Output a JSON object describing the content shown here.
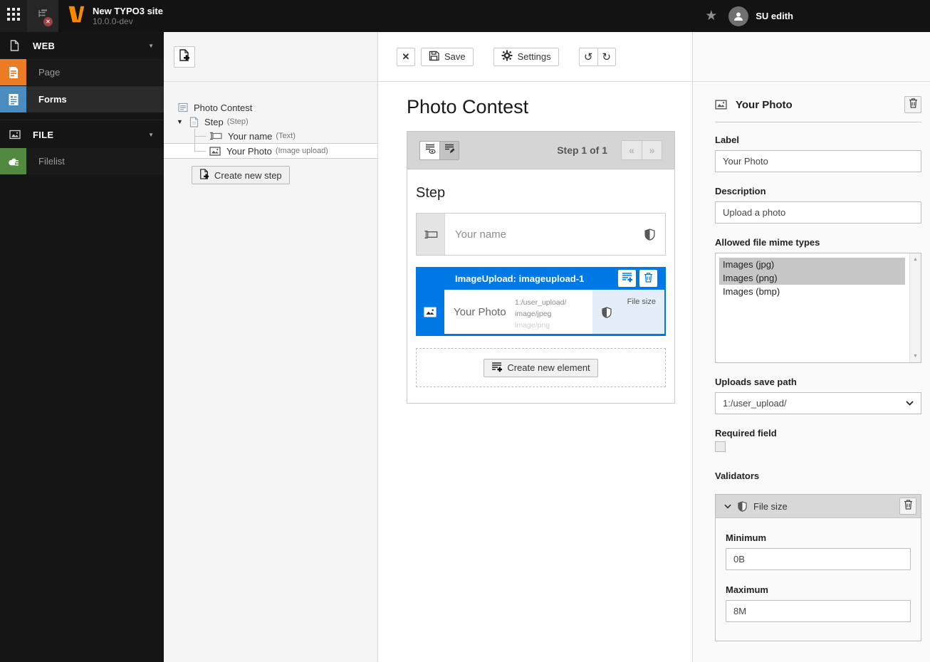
{
  "topbar": {
    "site_title": "New TYPO3 site",
    "site_version": "10.0.0-dev",
    "username": "SU edith"
  },
  "icons": {
    "close": "✕",
    "undo": "↺",
    "redo": "↻",
    "star": "★",
    "caret_down": "▼",
    "error_x": "✕",
    "scroll_up": "▲",
    "scroll_down": "▼"
  },
  "modulemenu": {
    "web_section": "WEB",
    "page": "Page",
    "forms": "Forms",
    "file_section": "FILE",
    "filelist": "Filelist"
  },
  "tree": {
    "root": "Photo Contest",
    "step_label": "Step",
    "step_type": "(Step)",
    "name_label": "Your name",
    "name_type": "(Text)",
    "photo_label": "Your Photo",
    "photo_type": "(Image upload)",
    "create_step": "Create new step"
  },
  "toolbar": {
    "save": "Save",
    "settings": "Settings"
  },
  "stage": {
    "title": "Photo Contest",
    "paginator": "Step 1 of 1",
    "prev": "«",
    "next": "»",
    "step_heading": "Step",
    "name_placeholder": "Your name",
    "selected_header": "ImageUpload: imageupload-1",
    "selected_label": "Your Photo",
    "meta_line1": "1:/user_upload/",
    "meta_line2": "image/jpeg",
    "meta_line3": "image/png",
    "validator_badge": "File size",
    "create_element": "Create new element"
  },
  "inspector": {
    "title": "Your Photo",
    "label_label": "Label",
    "label_value": "Your Photo",
    "description_label": "Description",
    "description_value": "Upload a photo",
    "mime_label": "Allowed file mime types",
    "mime_options": [
      "Images (jpg)",
      "Images (png)",
      "Images (bmp)"
    ],
    "mime_selected": [
      "Images (jpg)",
      "Images (png)"
    ],
    "save_path_label": "Uploads save path",
    "save_path_value": "1:/user_upload/",
    "required_label": "Required field",
    "required_checked": false,
    "validators_label": "Validators",
    "validator_title": "File size",
    "minimum_label": "Minimum",
    "minimum_value": "0B",
    "maximum_label": "Maximum",
    "maximum_value": "8M"
  },
  "colors": {
    "accent_blue": "#0078e6",
    "typo3_orange": "#ff8700",
    "page_module_orange": "#eb7c24",
    "forms_module_blue": "#4a8cbf",
    "filelist_module_green": "#51893f",
    "selected_validator_bg": "#e3eef9",
    "topbar_bg": "#131313"
  }
}
